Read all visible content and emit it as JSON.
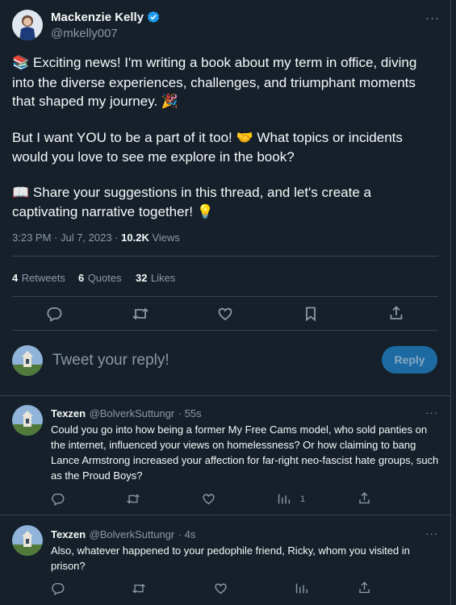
{
  "author": {
    "name": "Mackenzie Kelly",
    "handle": "@mkelly007"
  },
  "tweet": {
    "para1_emoji": "📚",
    "para1": "Exciting news! I'm writing a book about my term in office, diving into the diverse experiences, challenges, and triumphant moments that shaped my journey.",
    "para1_end_emoji": "🎉",
    "para2": "But I want YOU to be a part of it too!",
    "para2_emoji": "🤝",
    "para2_b": "What topics or incidents would you love to see me explore in the book?",
    "para3_emoji": "📖",
    "para3": "Share your suggestions in this thread, and let's create a captivating narrative together!",
    "para3_end_emoji": "💡",
    "timestamp": "3:23 PM · Jul 7, 2023 ·",
    "views_count": "10.2K",
    "views_label": "Views"
  },
  "stats": {
    "retweets_count": "4",
    "retweets_label": "Retweets",
    "quotes_count": "6",
    "quotes_label": "Quotes",
    "likes_count": "32",
    "likes_label": "Likes"
  },
  "composer": {
    "placeholder": "Tweet your reply!",
    "reply_button": "Reply"
  },
  "replies": [
    {
      "name": "Texzen",
      "handle": "@BolverkSuttungr",
      "time": "· 55s",
      "text": "Could you go into how being a former My Free Cams model, who sold panties on the internet, influenced your views on homelessness? Or how claiming to bang Lance Armstrong increased your affection for far-right neo-fascist hate groups, such as the Proud Boys?",
      "views": "1"
    },
    {
      "name": "Texzen",
      "handle": "@BolverkSuttungr",
      "time": "· 4s",
      "text": "Also, whatever happened to your pedophile friend, Ricky, whom you visited in prison?",
      "views": ""
    }
  ],
  "more_label": "···"
}
